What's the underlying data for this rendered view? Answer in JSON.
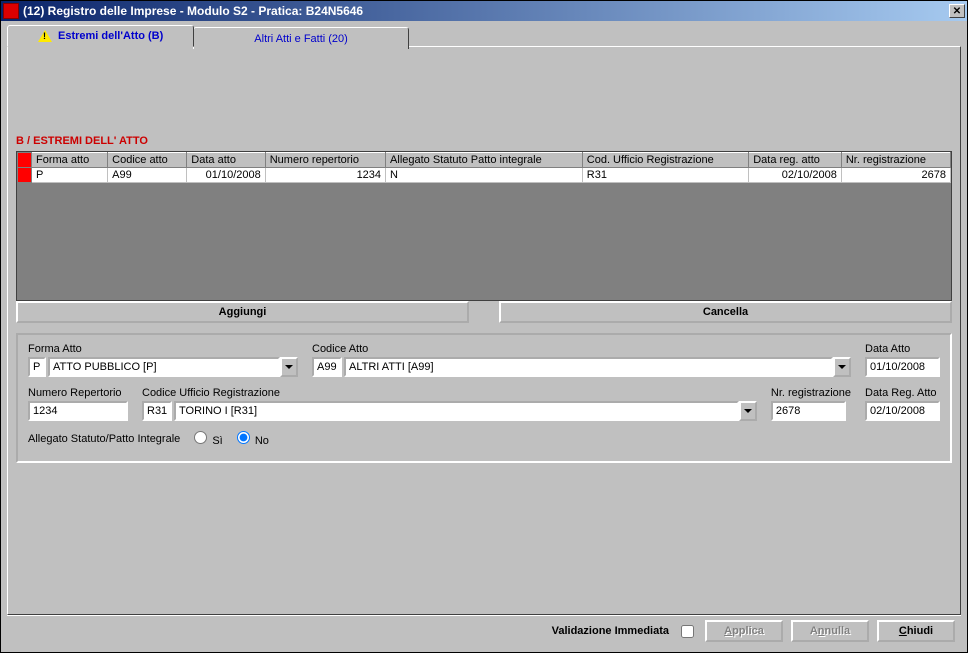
{
  "window": {
    "title": "(12) Registro delle Imprese - Modulo S2 - Pratica: B24N5646"
  },
  "tabs": {
    "active": "Estremi dell'Atto (B)",
    "other": "Altri Atti e Fatti (20)"
  },
  "section_title": "B / ESTREMI DELL' ATTO",
  "grid": {
    "headers": {
      "forma": "Forma atto",
      "codice": "Codice atto",
      "data": "Data atto",
      "numrep": "Numero repertorio",
      "allegato": "Allegato Statuto Patto integrale",
      "codufficio": "Cod. Ufficio Registrazione",
      "datareg": "Data reg. atto",
      "nrreg": "Nr. registrazione"
    },
    "row": {
      "forma": "P",
      "codice": "A99",
      "data": "01/10/2008",
      "numrep": "1234",
      "allegato": "N",
      "codufficio": "R31",
      "datareg": "02/10/2008",
      "nrreg": "2678"
    }
  },
  "buttons": {
    "aggiungi": "Aggiungi",
    "cancella": "Cancella"
  },
  "form": {
    "forma_label": "Forma Atto",
    "forma_code": "P",
    "forma_text": "ATTO PUBBLICO [P]",
    "codice_label": "Codice Atto",
    "codice_code": "A99",
    "codice_text": "ALTRI ATTI [A99]",
    "dataatto_label": "Data Atto",
    "dataatto": "01/10/2008",
    "numrep_label": "Numero Repertorio",
    "numrep": "1234",
    "codufficio_label": "Codice Ufficio Registrazione",
    "codufficio_code": "R31",
    "codufficio_text": "TORINO I [R31]",
    "nrreg_label": "Nr. registrazione",
    "nrreg": "2678",
    "datareg_label": "Data Reg. Atto",
    "datareg": "02/10/2008",
    "allegato_label": "Allegato Statuto/Patto Integrale",
    "si": "Sì",
    "no": "No"
  },
  "footer": {
    "validazione": "Validazione Immediata",
    "applica": "Applica",
    "annulla": "Annulla",
    "chiudi": "Chiudi"
  }
}
